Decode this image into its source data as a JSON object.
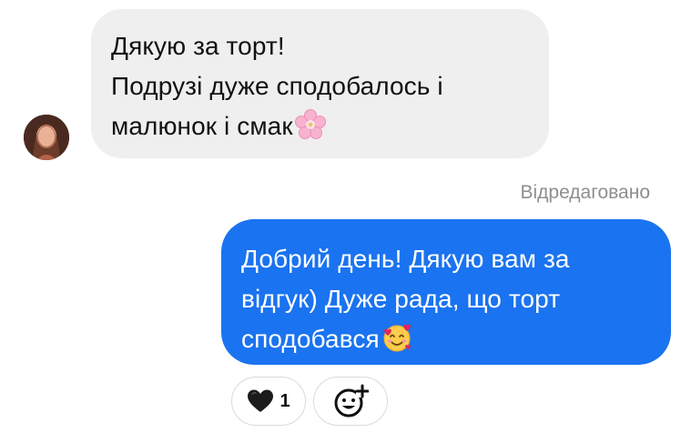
{
  "incoming": {
    "lines": [
      "Дякую за торт!",
      "Подрузі дуже сподобалось і",
      "малюнок і смак"
    ],
    "emoji": "cherry-blossom-icon"
  },
  "edited_label": "Відредаговано",
  "outgoing": {
    "lines": [
      "Добрий день! Дякую вам за",
      "відгук) Дуже рада, що торт",
      "сподобався"
    ],
    "emoji": "smiling-face-with-hearts-icon"
  },
  "reactions": {
    "heart_count": "1",
    "heart_icon": "black-heart-icon",
    "add_icon": "add-reaction-icon"
  },
  "colors": {
    "incoming_bubble": "#efefef",
    "outgoing_bubble": "#1a73f0",
    "edited_text": "#8e8e8e"
  }
}
